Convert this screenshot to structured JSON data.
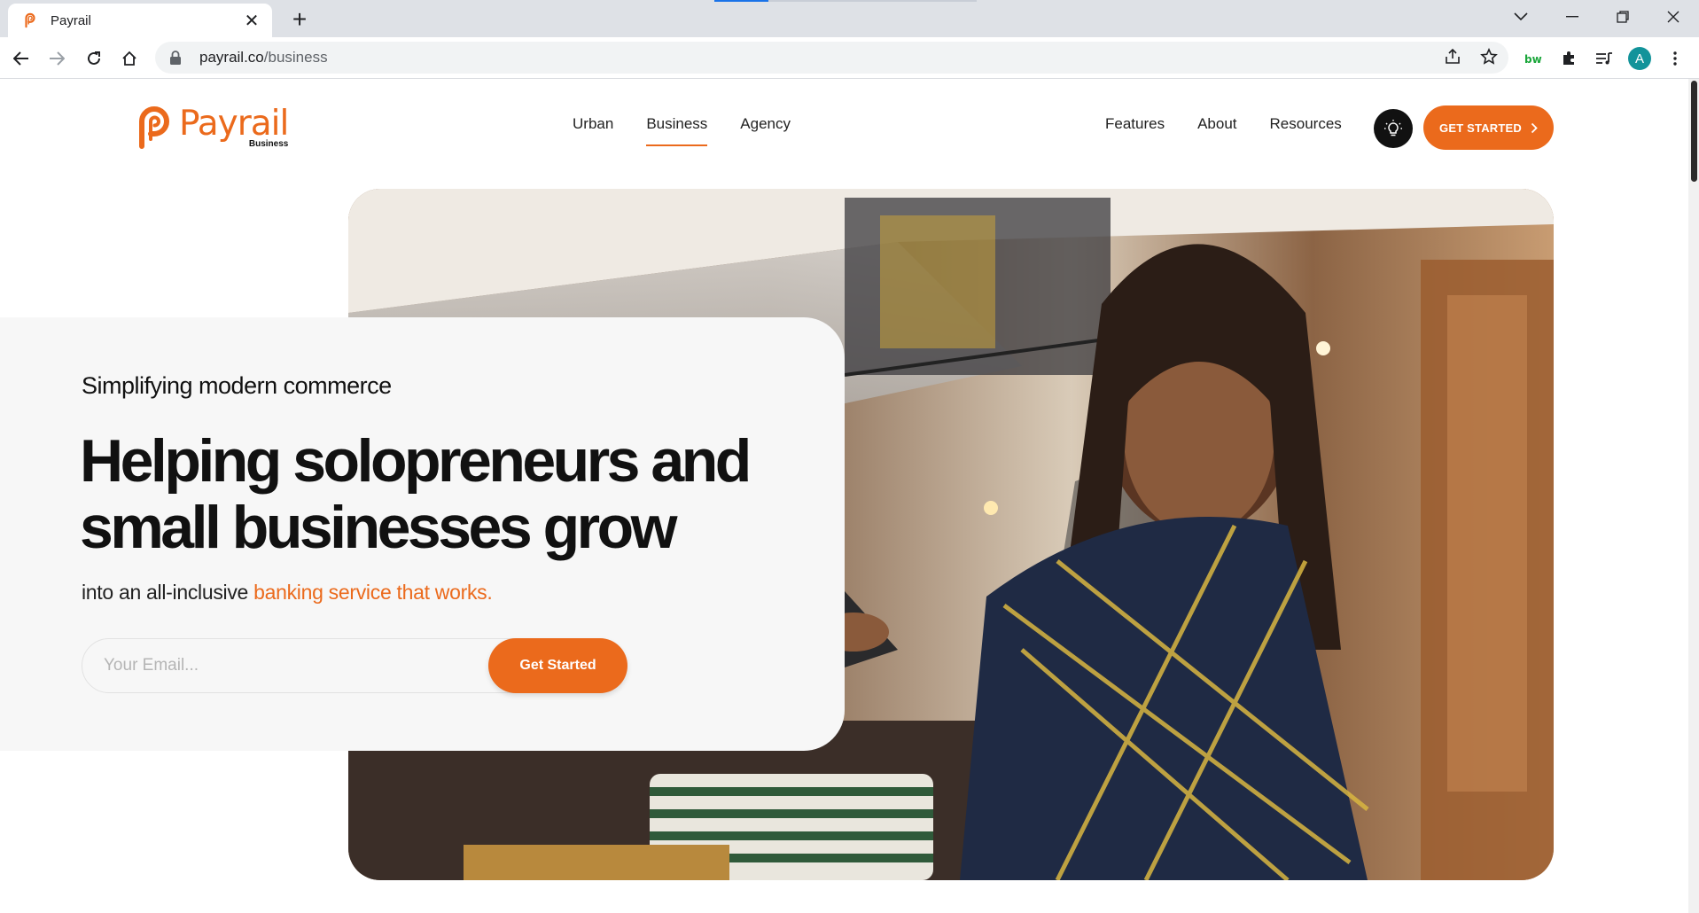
{
  "browser": {
    "tab_title": "Payrail",
    "url_host": "payrail.co",
    "url_path": "/business"
  },
  "site": {
    "brand": "Payrail",
    "brand_sub": "Business",
    "accent_color": "#eb6a1c",
    "main_nav": [
      "Urban",
      "Business",
      "Agency"
    ],
    "active_nav": "Business",
    "secondary_nav": [
      "Features",
      "About",
      "Resources"
    ],
    "cta_label": "GET STARTED"
  },
  "hero": {
    "eyebrow": "Simplifying modern commerce",
    "headline": "Helping solopreneurs and small businesses grow",
    "subline_prefix": "into an all-inclusive ",
    "subline_highlight": "banking service that works.",
    "email_placeholder": "Your Email...",
    "submit_label": "Get Started"
  }
}
